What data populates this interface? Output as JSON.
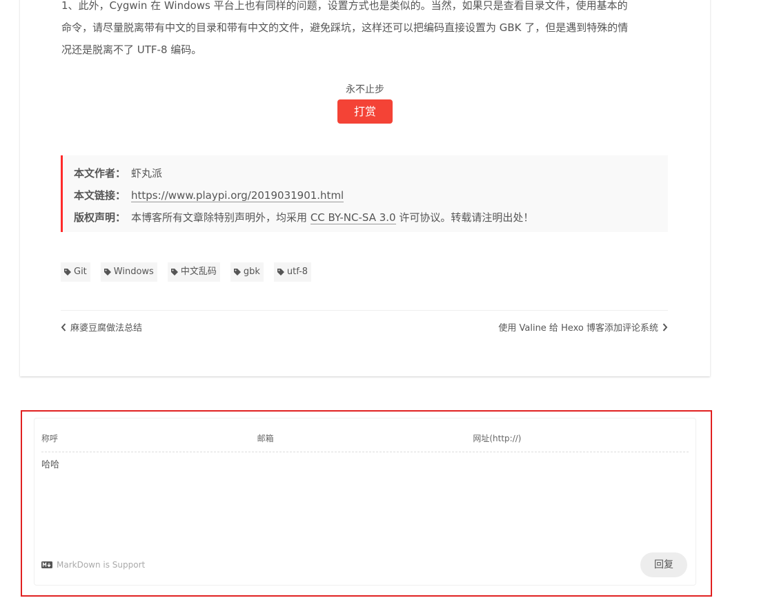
{
  "article": {
    "paragraph_lines": [
      "1、此外，Cygwin 在 Windows 平台上也有同样的问题，设置方式也是类似的。当然，如果只是查看目录文件，使用基本的",
      "命令，请尽量脱离带有中文的目录和带有中文的文件，避免踩坑，这样还可以把编码直接设置为 GBK 了，但是遇到特殊的情",
      "况还是脱离不了 UTF-8 编码。"
    ]
  },
  "reward": {
    "comment": "永不止步",
    "button_label": "打赏"
  },
  "copyright": {
    "author_label": "本文作者：",
    "author_value": "虾丸派",
    "link_label": "本文链接：",
    "link_value": "https://www.playpi.org/2019031901.html",
    "license_label": "版权声明：",
    "license_prefix": "本博客所有文章除特别声明外，均采用",
    "license_link": "CC BY-NC-SA 3.0",
    "license_suffix": "许可协议。转载请注明出处！"
  },
  "tags": [
    "Git",
    "Windows",
    "中文乱码",
    "gbk",
    "utf-8"
  ],
  "post_nav": {
    "prev": "麻婆豆腐做法总结",
    "next": "使用 Valine 给 Hexo 博客添加评论系统"
  },
  "comment_form": {
    "nick_placeholder": "称呼",
    "mail_placeholder": "邮箱",
    "link_placeholder": "网址(http://)",
    "comment_value": "哈哈",
    "markdown_support": "MarkDown is Support",
    "reply_label": "回复"
  },
  "colors": {
    "reward_button": "#f44336",
    "copyright_border": "#ff2a2a",
    "highlight_box": "#e02020",
    "tag_background": "#f5f5f5"
  }
}
